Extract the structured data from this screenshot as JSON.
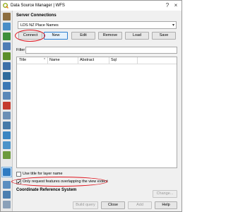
{
  "window": {
    "title": "Data Source Manager | WFS"
  },
  "server_connections": {
    "heading": "Server Connections",
    "selected_connection": "LDS NZ Place Names",
    "buttons": {
      "connect": "Connect",
      "new": "New",
      "edit": "Edit",
      "remove": "Remove",
      "load": "Load",
      "save": "Save"
    }
  },
  "filter": {
    "label": "Filter",
    "value": ""
  },
  "layer_table": {
    "columns": [
      "Title",
      "Name",
      "Abstract",
      "Sql"
    ],
    "rows": []
  },
  "options": {
    "use_title_label": "Use title for layer name",
    "use_title_checked": false,
    "only_request_label": "Only request features overlapping the view extent",
    "only_request_checked": true
  },
  "crs": {
    "heading": "Coordinate Reference System",
    "change_label": "Change..."
  },
  "footer": {
    "build_query": "Build query",
    "close": "Close",
    "add": "Add",
    "help": "Help"
  },
  "colors": {
    "annotation": "#e0141e",
    "accent": "#2d7fd0",
    "qgis_green": "#93b023"
  }
}
